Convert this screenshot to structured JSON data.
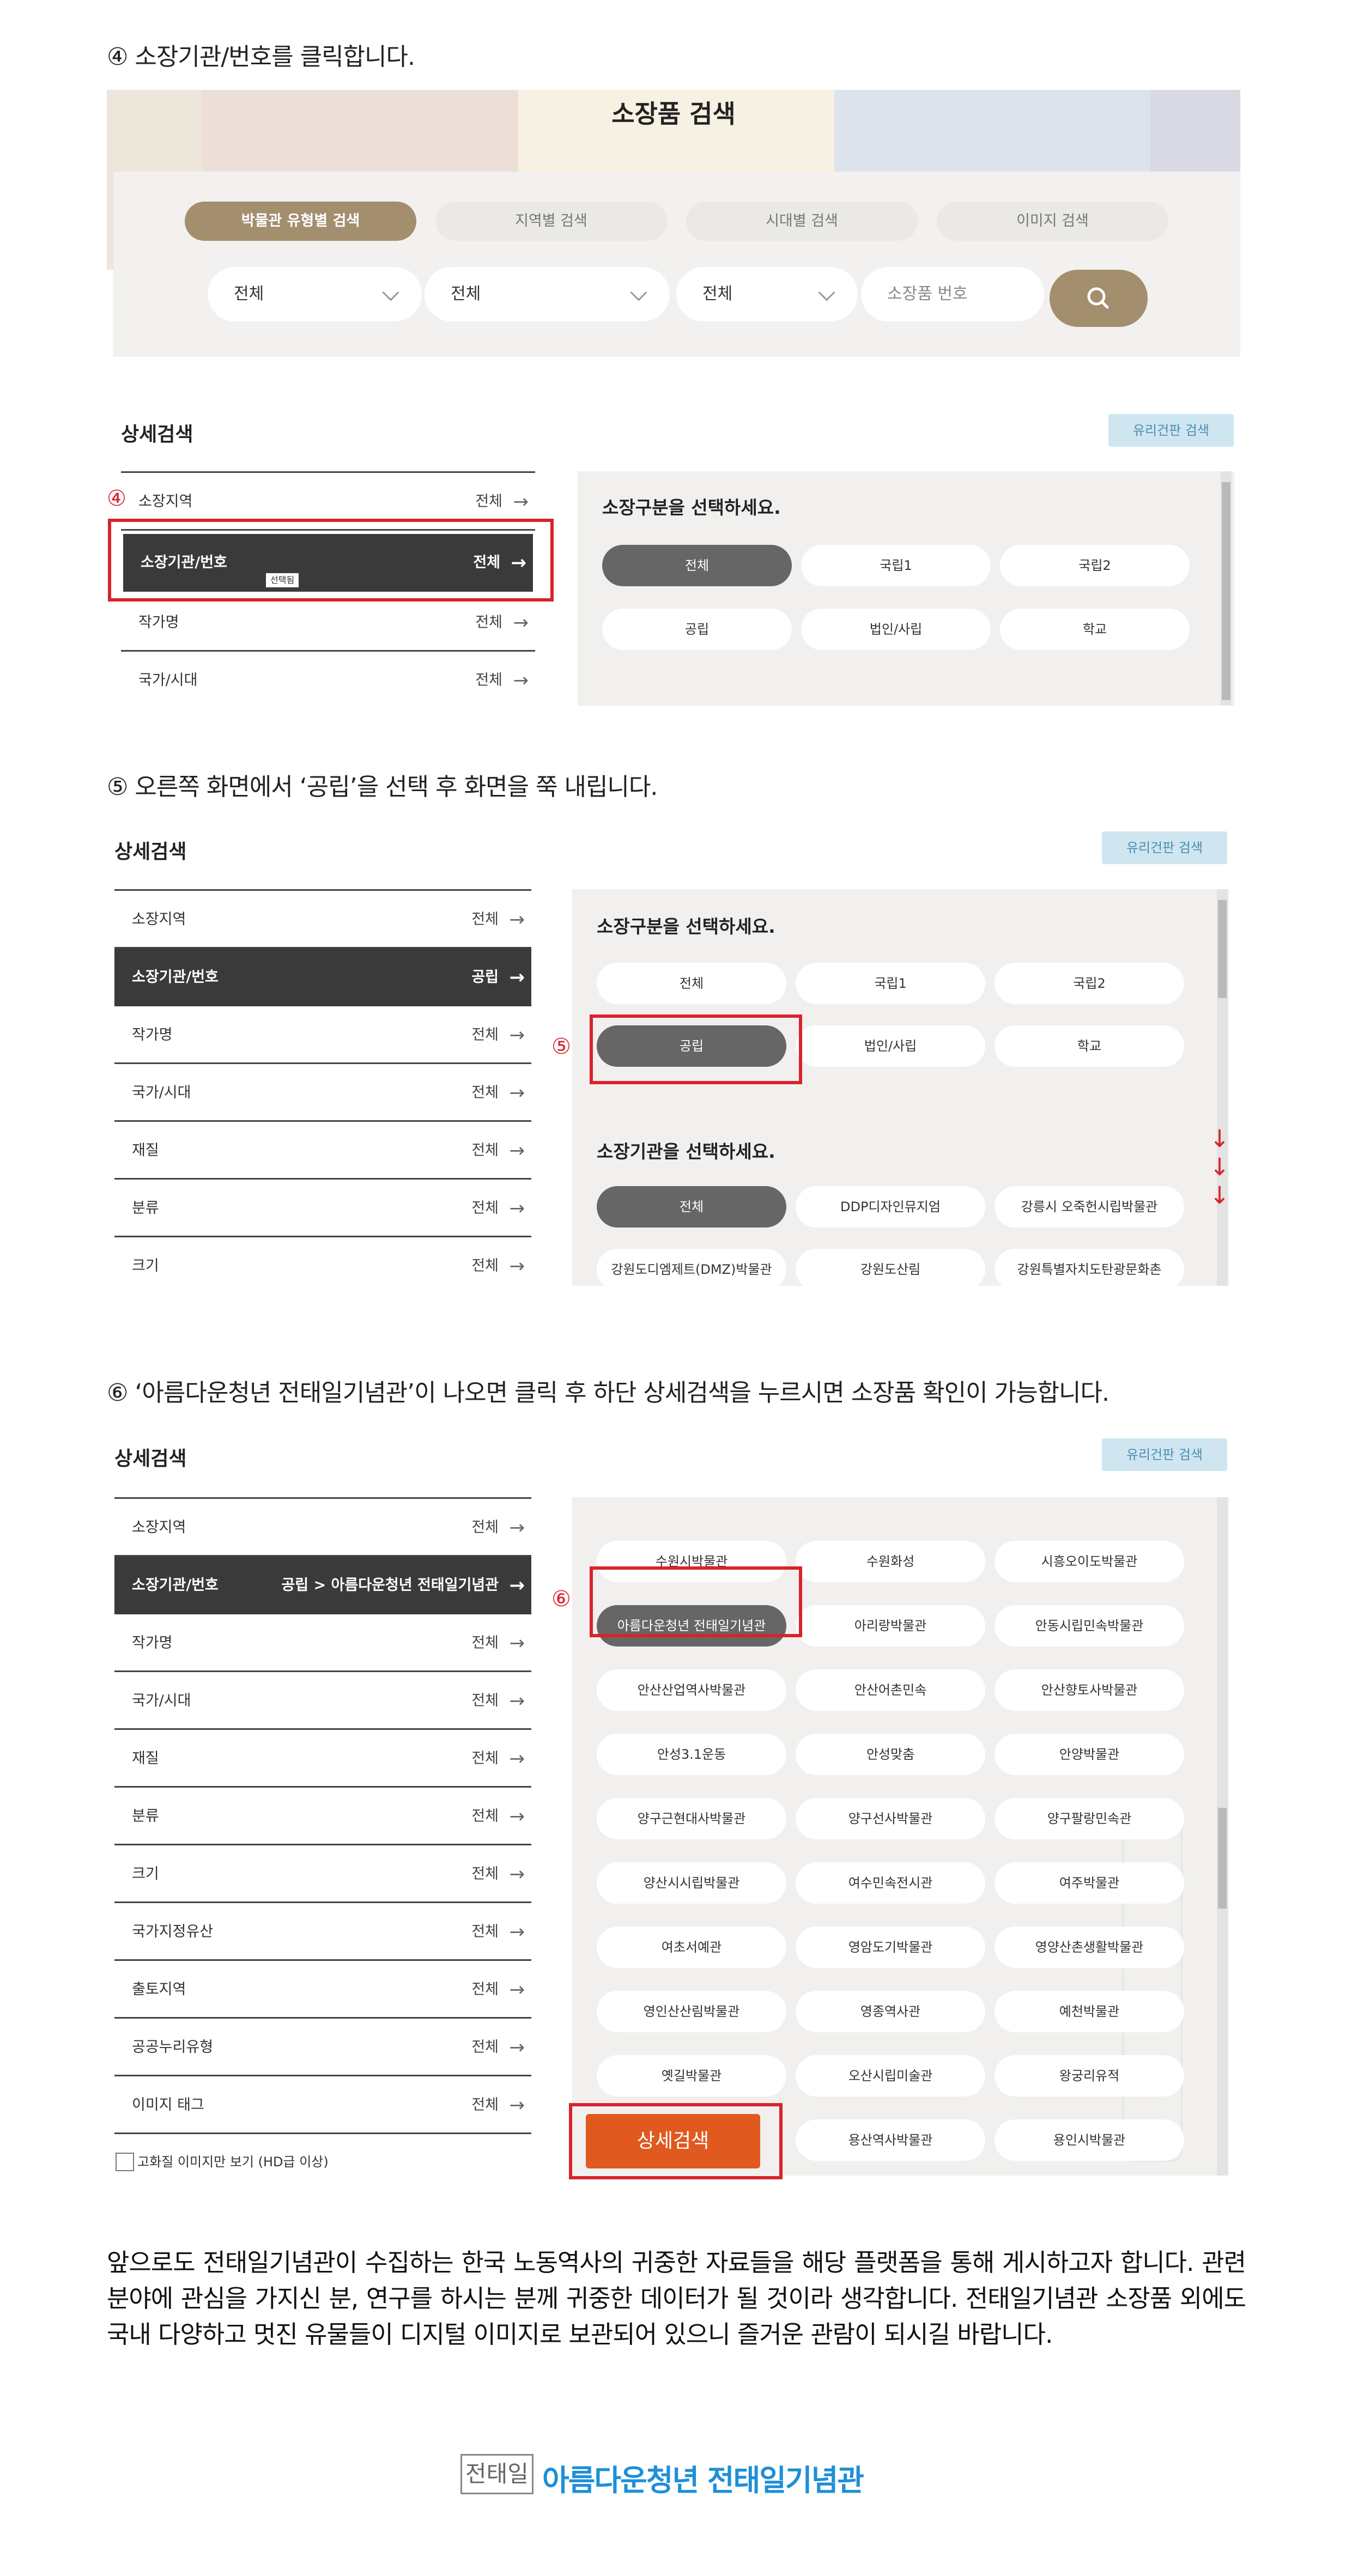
{
  "step4": {
    "text": "④ 소장기관/번호를 클릭합니다."
  },
  "search": {
    "title": "소장품 검색",
    "tabs": [
      "박물관 유형별 검색",
      "지역별 검색",
      "시대별 검색",
      "이미지 검색"
    ],
    "selects": [
      "전체",
      "전체",
      "전체"
    ],
    "number_placeholder": "소장품 번호",
    "colors": {
      "accent": "#a38e6e",
      "background": "#f2f1ef"
    }
  },
  "detail_label": "상세검색",
  "glass_label": "유리건판 검색",
  "panel1": {
    "marker": "④",
    "menu": [
      {
        "label": "소장지역",
        "value": "전체"
      },
      {
        "label": "소장기관/번호",
        "value": "전체",
        "badge": "선택됨"
      },
      {
        "label": "작가명",
        "value": "전체"
      },
      {
        "label": "국가/시대",
        "value": "전체"
      }
    ],
    "section_title": "소장구분을 선택하세요.",
    "chips": [
      "전체",
      "국립1",
      "국립2",
      "공립",
      "법인/사립",
      "학교"
    ]
  },
  "step5": {
    "text": "⑤ 오른쪽 화면에서 ‘공립’을 선택 후 화면을 쭉 내립니다."
  },
  "panel2": {
    "marker": "⑤",
    "menu": [
      {
        "label": "소장지역",
        "value": "전체"
      },
      {
        "label": "소장기관/번호",
        "value": "공립"
      },
      {
        "label": "작가명",
        "value": "전체"
      },
      {
        "label": "국가/시대",
        "value": "전체"
      },
      {
        "label": "재질",
        "value": "전체"
      },
      {
        "label": "분류",
        "value": "전체"
      },
      {
        "label": "크기",
        "value": "전체"
      }
    ],
    "section1_title": "소장구분을 선택하세요.",
    "chips1": [
      "전체",
      "국립1",
      "국립2",
      "공립",
      "법인/사립",
      "학교"
    ],
    "section2_title": "소장기관을 선택하세요.",
    "chips2": [
      "전체",
      "DDP디자인뮤지엄",
      "강릉시 오죽헌시립박물관",
      "강원도디엠제트(DMZ)박물관",
      "강원도산림",
      "강원특별자치도탄광문화촌"
    ],
    "arrows": [
      "↓",
      "↓",
      "↓"
    ]
  },
  "step6": {
    "text": "⑥ ‘아름다운청년 전태일기념관’이 나오면 클릭 후 하단 상세검색을 누르시면 소장품 확인이 가능합니다."
  },
  "panel3": {
    "marker": "⑥",
    "menu": [
      {
        "label": "소장지역",
        "value": "전체"
      },
      {
        "label": "소장기관/번호",
        "value": "공립 > 아름다운청년 전태일기념관"
      },
      {
        "label": "작가명",
        "value": "전체"
      },
      {
        "label": "국가/시대",
        "value": "전체"
      },
      {
        "label": "재질",
        "value": "전체"
      },
      {
        "label": "분류",
        "value": "전체"
      },
      {
        "label": "크기",
        "value": "전체"
      },
      {
        "label": "국가지정유산",
        "value": "전체"
      },
      {
        "label": "출토지역",
        "value": "전체"
      },
      {
        "label": "공공누리유형",
        "value": "전체"
      },
      {
        "label": "이미지 태그",
        "value": "전체"
      }
    ],
    "hd_checkbox": "고화질 이미지만 보기 (HD급 이상)",
    "chips": [
      "수원시박물관",
      "수원화성",
      "시흥오이도박물관",
      "아름다운청년 전태일기념관",
      "아리랑박물관",
      "안동시립민속박물관",
      "안산산업역사박물관",
      "안산어촌민속",
      "안산향토사박물관",
      "안성3.1운동",
      "안성맞춤",
      "안양박물관",
      "양구근현대사박물관",
      "양구선사박물관",
      "양구팔랑민속관",
      "양산시시립박물관",
      "여수민속전시관",
      "여주박물관",
      "여초서예관",
      "영암도기박물관",
      "영양산촌생활박물관",
      "영인산산림박물관",
      "영종역사관",
      "예천박물관",
      "옛길박물관",
      "오산시립미술관",
      "왕궁리유적",
      "",
      "용산역사박물관",
      "용인시박물관"
    ],
    "detail_button": "상세검색"
  },
  "closing": "앞으로도 전태일기념관이 수집하는 한국 노동역사의 귀중한 자료들을 해당 플랫폼을 통해 게시하고자 합니다. 관련 분야에 관심을 가지신 분, 연구를 하시는 분께 귀중한 데이터가 될 것이라 생각합니다. 전태일기념관 소장품 외에도 국내 다양하고 멋진 유물들이 디지털 이미지로 보관되어 있으니 즐거운 관람이 되시길 바랍니다.",
  "logo": {
    "mark": "전태일",
    "name": "아름다운청년 전태일기념관",
    "color": "#1e8fd8"
  }
}
